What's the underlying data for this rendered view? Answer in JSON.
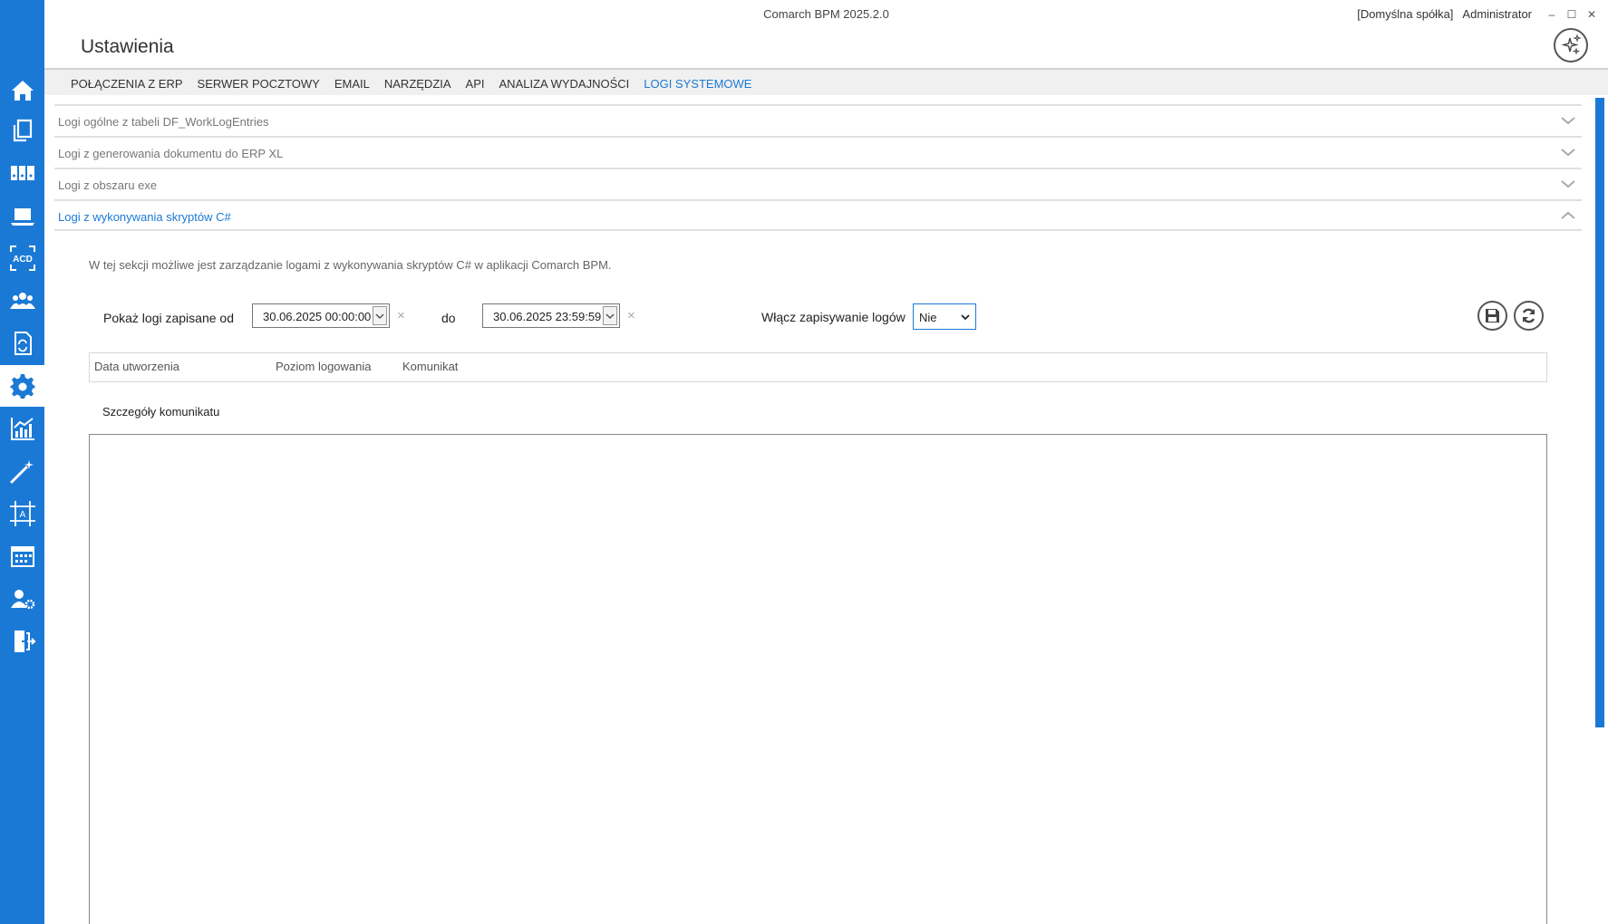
{
  "window": {
    "app_title": "Comarch BPM 2025.2.0",
    "company": "[Domyślna spółka]",
    "user": "Administrator",
    "min_glyph": "–",
    "max_glyph": "☐",
    "close_glyph": "✕"
  },
  "page": {
    "title": "Ustawienia"
  },
  "sidebar": {
    "items": [
      {
        "icon": "home-icon"
      },
      {
        "icon": "documents-icon"
      },
      {
        "icon": "binders-icon"
      },
      {
        "icon": "laptop-icon"
      },
      {
        "icon": "acd-icon",
        "text": "ACD"
      },
      {
        "icon": "users-icon"
      },
      {
        "icon": "document-sync-icon"
      },
      {
        "icon": "gear-icon",
        "active": true
      },
      {
        "icon": "analytics-icon"
      },
      {
        "icon": "magic-wand-icon"
      },
      {
        "icon": "frame-text-icon",
        "text": "A"
      },
      {
        "icon": "calendar-icon"
      },
      {
        "icon": "user-settings-icon"
      },
      {
        "icon": "logout-icon"
      }
    ],
    "accent": "#1b79d6"
  },
  "menu": {
    "items": [
      "POŁĄCZENIA Z ERP",
      "SERWER POCZTOWY",
      "EMAIL",
      "NARZĘDZIA",
      "API",
      "ANALIZA WYDAJNOŚCI",
      "LOGI SYSTEMOWE"
    ],
    "active": "LOGI SYSTEMOWE"
  },
  "accordion": {
    "sections": [
      {
        "label": "Logi ogólne z tabeli DF_WorkLogEntries",
        "expanded": false
      },
      {
        "label": "Logi z generowania dokumentu do ERP XL",
        "expanded": false
      },
      {
        "label": "Logi z obszaru exe",
        "expanded": false
      },
      {
        "label": "Logi z wykonywania skryptów C#",
        "expanded": true
      }
    ]
  },
  "section": {
    "description": "W tej sekcji możliwe jest zarządzanie logami z wykonywania skryptów C# w aplikacji Comarch BPM.",
    "from_label": "Pokaż logi zapisane od",
    "from_value": "30.06.2025 00:00:00",
    "to_label": "do",
    "to_value": "30.06.2025 23:59:59",
    "clear_glyph": "×",
    "logging_label": "Włącz zapisywanie logów",
    "logging_value": "Nie",
    "columns": [
      "Data utworzenia",
      "Poziom logowania",
      "Komunikat"
    ],
    "details_label": "Szczegóły komunikatu"
  }
}
